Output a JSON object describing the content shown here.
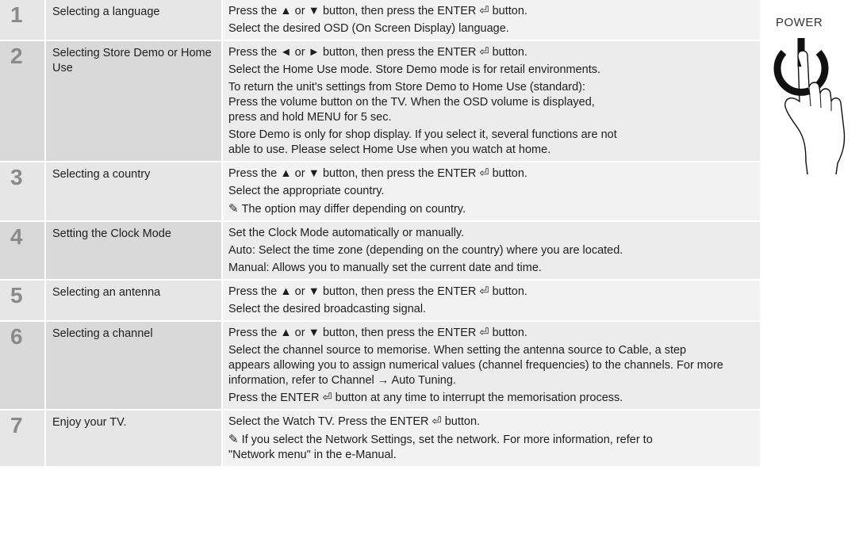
{
  "power_label": "POWER",
  "steps": [
    {
      "num": "1",
      "title": "Selecting a language",
      "lines": [
        "Press the ▲ or ▼ button, then press the ENTER ⏎ button.",
        "Select the desired OSD (On Screen Display) language."
      ]
    },
    {
      "num": "2",
      "title": "Selecting Store Demo or Home Use",
      "lines": [
        "Press the ◄ or ► button, then press the ENTER ⏎ button.",
        "Select the Home Use mode. Store Demo mode is for retail environments.",
        "To return the unit's settings from Store Demo to Home Use (standard):\nPress the volume button on the TV. When the OSD volume is displayed,\npress and hold MENU for 5 sec.",
        "Store Demo is only for shop display. If you select it, several functions are not\nable to use. Please select Home Use when you watch at home."
      ]
    },
    {
      "num": "3",
      "title": "Selecting a country",
      "lines": [
        "Press the ▲ or ▼ button, then press the ENTER ⏎ button.",
        "Select the appropriate country."
      ],
      "note": "The option may differ depending on country."
    },
    {
      "num": "4",
      "title": "Setting the Clock Mode",
      "lines": [
        "Set the Clock Mode automatically or manually.",
        "Auto: Select the time zone (depending on the country) where you are located.",
        "Manual: Allows you to manually set the current date and time."
      ]
    },
    {
      "num": "5",
      "title": "Selecting an antenna",
      "lines": [
        "Press the ▲ or ▼ button, then press the ENTER ⏎ button.",
        "Select the desired broadcasting signal."
      ]
    },
    {
      "num": "6",
      "title": "Selecting a channel",
      "lines": [
        "Press the ▲ or ▼ button, then press the ENTER ⏎ button.",
        "Select the channel source to memorise. When setting the antenna source to Cable, a step\nappears allowing you to assign numerical values (channel frequencies) to the channels. For more\ninformation, refer to Channel → Auto Tuning.",
        "Press the ENTER ⏎ button at any time to interrupt the memorisation process."
      ]
    },
    {
      "num": "7",
      "title": "Enjoy your TV.",
      "lines": [
        "Select the Watch TV. Press the ENTER ⏎ button."
      ],
      "note": "If you select the Network Settings, set the network. For more information, refer to\n\"Network menu\" in the e-Manual."
    }
  ]
}
